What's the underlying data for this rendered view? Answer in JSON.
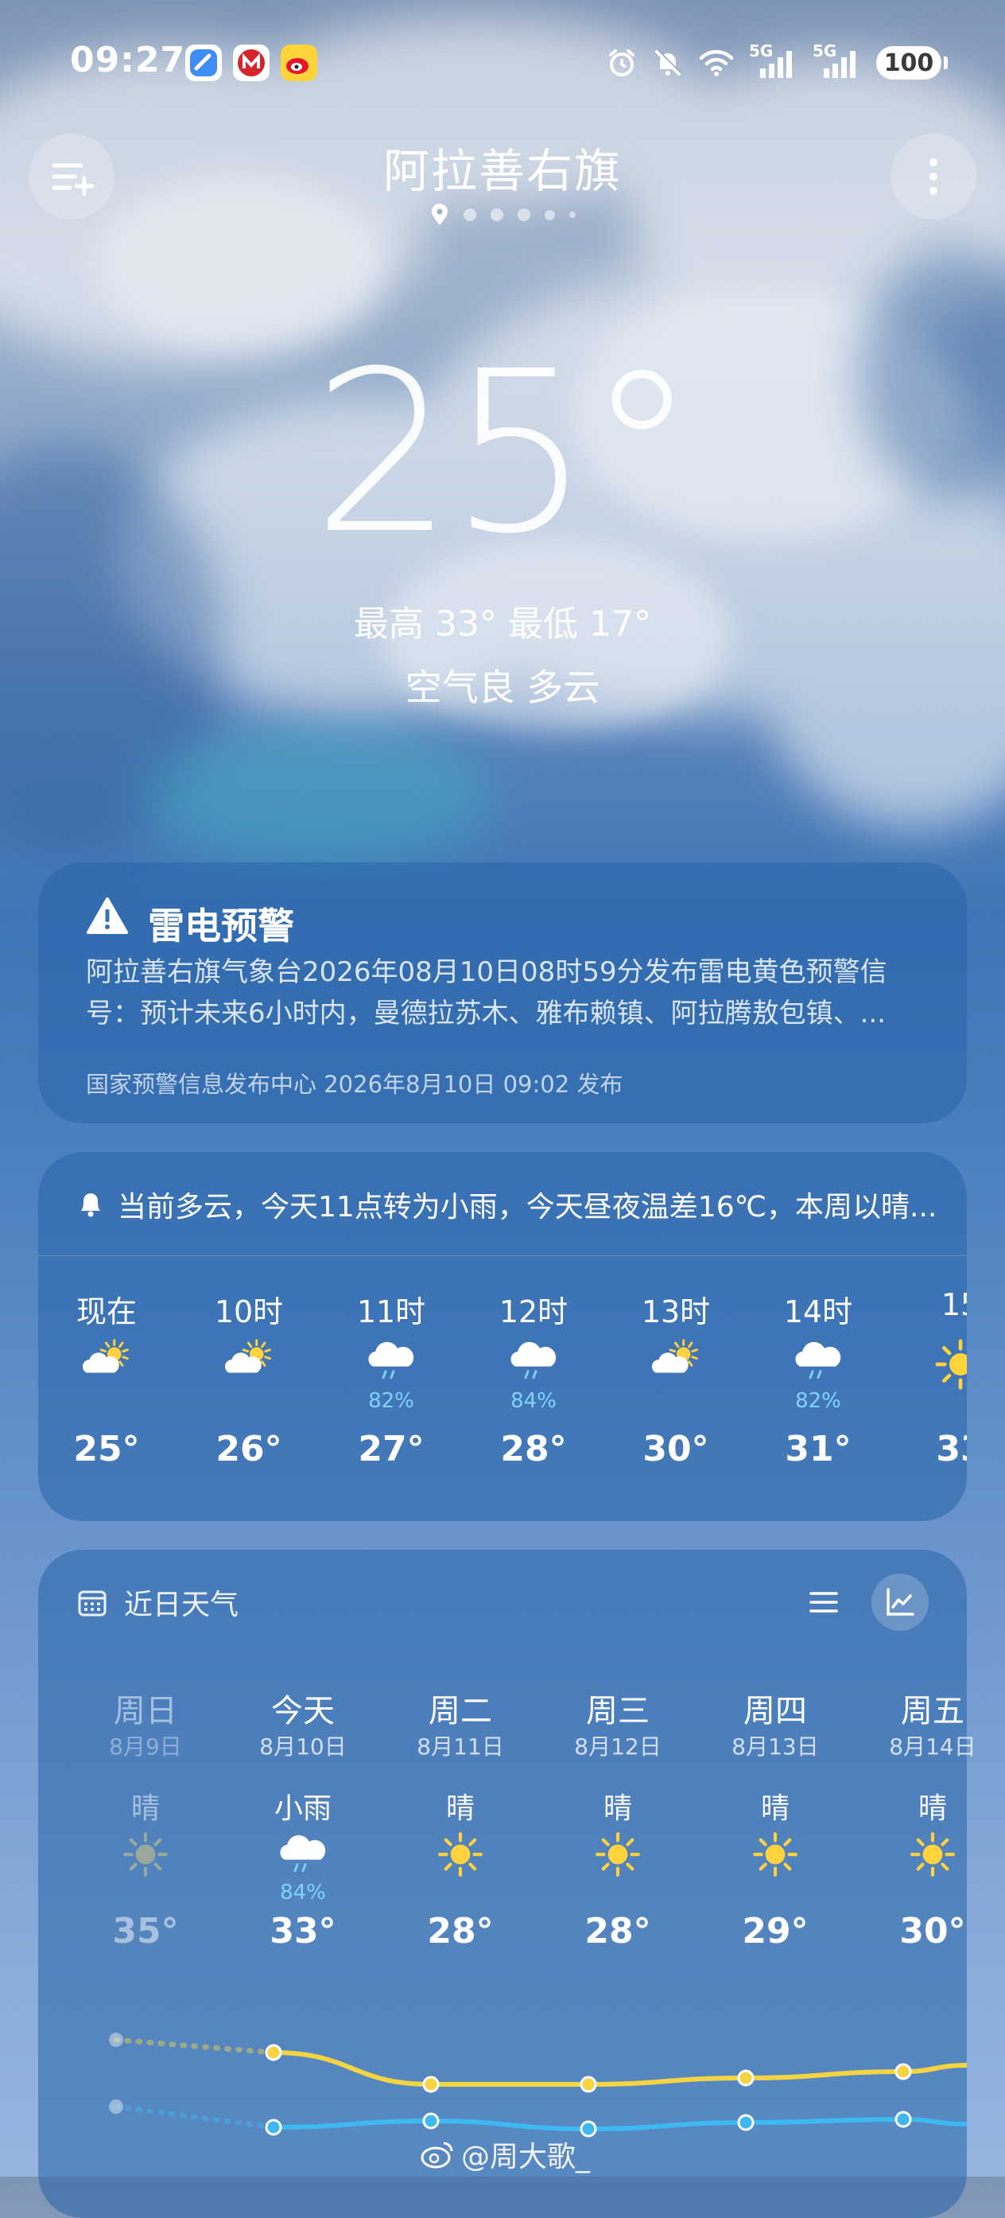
{
  "status_bar": {
    "time": "09:27",
    "network_1": "5G",
    "network_2": "5G",
    "battery": "100"
  },
  "header": {
    "city": "阿拉善右旗",
    "page_count": 6
  },
  "current": {
    "temperature": "25°",
    "high_low": "最高 33° 最低 17°",
    "air_and_condition": "空气良  多云"
  },
  "alert": {
    "title": "雷电预警",
    "body": "阿拉善右旗气象台2026年08月10日08时59分发布雷电黄色预警信号：预计未来6小时内，曼德拉苏木、雅布赖镇、阿拉腾敖包镇、...",
    "source": "国家预警信息发布中心 2026年8月10日 09:02 发布"
  },
  "hourly": {
    "summary": "当前多云，今天11点转为小雨，今天昼夜温差16℃，本周以晴...",
    "items": [
      {
        "label": "现在",
        "icon": "partly-cloudy-icon",
        "precip": "",
        "temp": "25°"
      },
      {
        "label": "10时",
        "icon": "partly-cloudy-icon",
        "precip": "",
        "temp": "26°"
      },
      {
        "label": "11时",
        "icon": "light-rain-icon",
        "precip": "82%",
        "temp": "27°"
      },
      {
        "label": "12时",
        "icon": "light-rain-icon",
        "precip": "84%",
        "temp": "28°"
      },
      {
        "label": "13时",
        "icon": "partly-cloudy-icon",
        "precip": "",
        "temp": "30°"
      },
      {
        "label": "14时",
        "icon": "light-rain-icon",
        "precip": "82%",
        "temp": "31°"
      },
      {
        "label": "15",
        "icon": "sunny-icon",
        "precip": "",
        "temp": "33"
      }
    ]
  },
  "forecast": {
    "title": "近日天气",
    "days": [
      {
        "name": "周日",
        "date": "8月9日",
        "cond": "晴",
        "icon": "sunny-icon",
        "precip": "",
        "high": "35°",
        "past": true
      },
      {
        "name": "今天",
        "date": "8月10日",
        "cond": "小雨",
        "icon": "light-rain-icon",
        "precip": "84%",
        "high": "33°",
        "past": false
      },
      {
        "name": "周二",
        "date": "8月11日",
        "cond": "晴",
        "icon": "sunny-icon",
        "precip": "",
        "high": "28°",
        "past": false
      },
      {
        "name": "周三",
        "date": "8月12日",
        "cond": "晴",
        "icon": "sunny-icon",
        "precip": "",
        "high": "28°",
        "past": false
      },
      {
        "name": "周四",
        "date": "8月13日",
        "cond": "晴",
        "icon": "sunny-icon",
        "precip": "",
        "high": "29°",
        "past": false
      },
      {
        "name": "周五",
        "date": "8月14日",
        "cond": "晴",
        "icon": "sunny-icon",
        "precip": "",
        "high": "30°",
        "past": false
      }
    ]
  },
  "watermark": "@周大歌_",
  "colors": {
    "high_line": "#f5d442",
    "low_line": "#3db8f0",
    "precip_text": "#80d3ff",
    "sun": "#ffd23e"
  }
}
